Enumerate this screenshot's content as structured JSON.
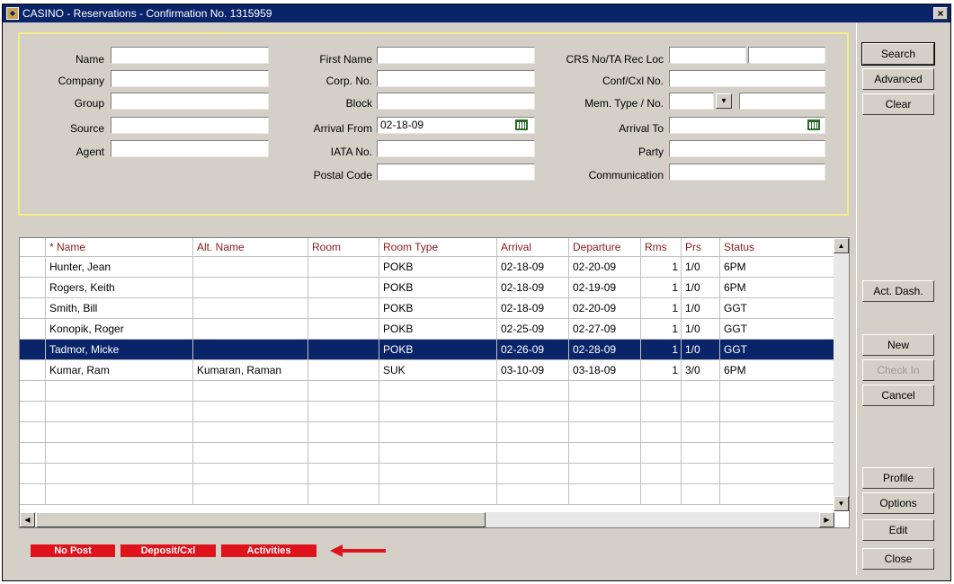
{
  "window": {
    "title": "CASINO - Reservations - Confirmation No. 1315959",
    "close": "×"
  },
  "search": {
    "name_label": "Name",
    "name_value": "",
    "company_label": "Company",
    "company_value": "",
    "group_label": "Group",
    "group_value": "",
    "source_label": "Source",
    "source_value": "",
    "agent_label": "Agent",
    "agent_value": "",
    "first_name_label": "First Name",
    "first_name_value": "",
    "corp_no_label": "Corp. No.",
    "corp_no_value": "",
    "block_label": "Block",
    "block_value": "",
    "arrival_from_label": "Arrival From",
    "arrival_from_value": "02-18-09",
    "iata_label": "IATA No.",
    "iata_value": "",
    "postal_label": "Postal Code",
    "postal_value": "",
    "crs_label": "CRS No/TA Rec Loc",
    "crs_value": "",
    "crs_value2": "",
    "conf_label": "Conf/Cxl No.",
    "conf_value": "",
    "mem_label": "Mem. Type / No.",
    "mem_type_value": "",
    "mem_no_value": "",
    "arrival_to_label": "Arrival To",
    "arrival_to_value": "",
    "party_label": "Party",
    "party_value": "",
    "comm_label": "Communication",
    "comm_value": ""
  },
  "grid": {
    "columns": [
      "* Name",
      "Alt. Name",
      "Room",
      "Room Type",
      "Arrival",
      "Departure",
      "Rms",
      "Prs",
      "Status"
    ],
    "rows": [
      {
        "name": "Hunter, Jean",
        "alt": "",
        "room": "",
        "type": "POKB",
        "arrival": "02-18-09",
        "departure": "02-20-09",
        "rms": "1",
        "prs": "1/0",
        "status": "6PM"
      },
      {
        "name": "Rogers, Keith",
        "alt": "",
        "room": "",
        "type": "POKB",
        "arrival": "02-18-09",
        "departure": "02-19-09",
        "rms": "1",
        "prs": "1/0",
        "status": "6PM"
      },
      {
        "name": "Smith, Bill",
        "alt": "",
        "room": "",
        "type": "POKB",
        "arrival": "02-18-09",
        "departure": "02-20-09",
        "rms": "1",
        "prs": "1/0",
        "status": "GGT"
      },
      {
        "name": "Konopik, Roger",
        "alt": "",
        "room": "",
        "type": "POKB",
        "arrival": "02-25-09",
        "departure": "02-27-09",
        "rms": "1",
        "prs": "1/0",
        "status": "GGT"
      },
      {
        "name": "Tadmor, Micke",
        "alt": "",
        "room": "",
        "type": "POKB",
        "arrival": "02-26-09",
        "departure": "02-28-09",
        "rms": "1",
        "prs": "1/0",
        "status": "GGT"
      },
      {
        "name": "Kumar, Ram",
        "alt": "Kumaran, Raman",
        "room": "",
        "type": "SUK",
        "arrival": "03-10-09",
        "departure": "03-18-09",
        "rms": "1",
        "prs": "3/0",
        "status": "6PM"
      }
    ],
    "selected_index": 4
  },
  "sidebar": {
    "search": "Search",
    "advanced": "Advanced",
    "clear": "Clear",
    "act_dash": "Act. Dash.",
    "new": "New",
    "check_in": "Check In",
    "cancel": "Cancel",
    "profile": "Profile",
    "options": "Options",
    "edit": "Edit",
    "close": "Close"
  },
  "footer": {
    "no_post": "No Post",
    "deposit_cxl": "Deposit/Cxl",
    "activities": "Activities"
  },
  "colors": {
    "selection": "#0a246a",
    "title_bar": "#0a246a",
    "highlight_red": "#e0121b",
    "panel_border": "#f2ee84",
    "header_text": "#8b1a1a"
  }
}
